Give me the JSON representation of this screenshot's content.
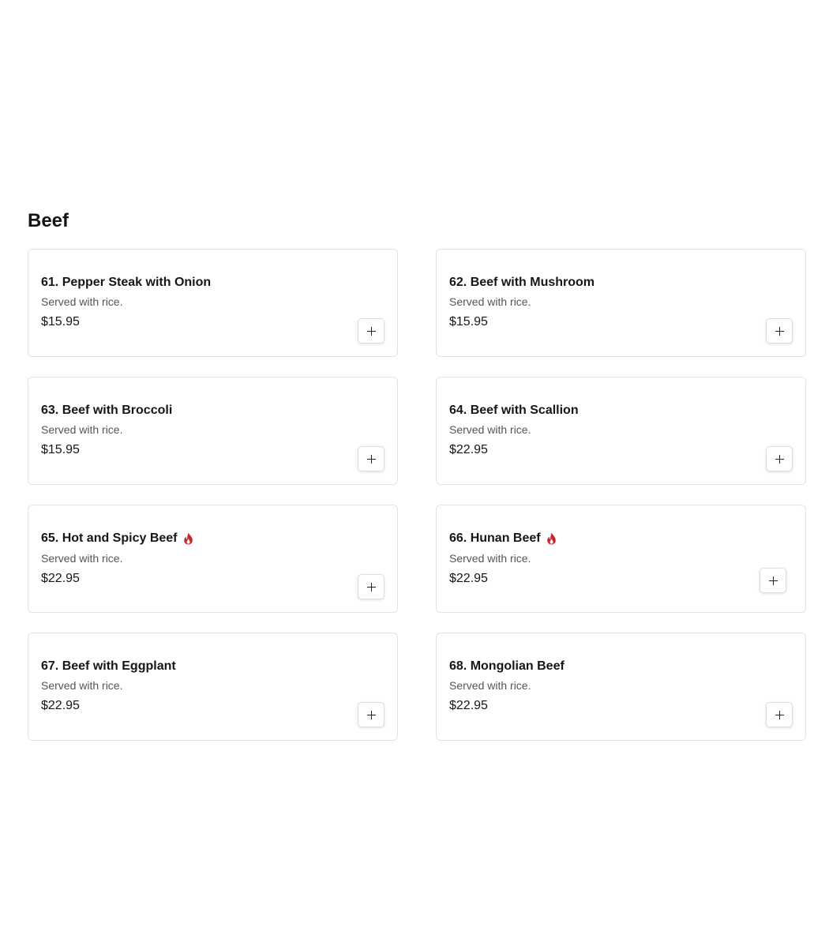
{
  "section": {
    "title": "Beef"
  },
  "colors": {
    "spicy": "#c62828",
    "card_border": "#e3e3e3",
    "text": "#161616",
    "muted": "#555555"
  },
  "items": [
    {
      "name": "61. Pepper Steak with Onion",
      "description": "Served with rice.",
      "price": "$15.95",
      "spicy": false,
      "add_icon": "plus-icon"
    },
    {
      "name": "62. Beef with Mushroom",
      "description": "Served with rice.",
      "price": "$15.95",
      "spicy": false,
      "add_icon": "plus-icon"
    },
    {
      "name": "63. Beef with Broccoli",
      "description": "Served with rice.",
      "price": "$15.95",
      "spicy": false,
      "add_icon": "plus-icon"
    },
    {
      "name": "64. Beef with Scallion",
      "description": "Served with rice.",
      "price": "$22.95",
      "spicy": false,
      "add_icon": "plus-icon"
    },
    {
      "name": "65. Hot and Spicy Beef",
      "description": "Served with rice.",
      "price": "$22.95",
      "spicy": true,
      "spicy_icon": "flame-icon",
      "add_icon": "plus-icon"
    },
    {
      "name": "66. Hunan Beef",
      "description": "Served with rice.",
      "price": "$22.95",
      "spicy": true,
      "spicy_icon": "flame-icon",
      "add_icon": "plus-icon"
    },
    {
      "name": "67. Beef with Eggplant",
      "description": "Served with rice.",
      "price": "$22.95",
      "spicy": false,
      "add_icon": "plus-icon"
    },
    {
      "name": "68. Mongolian Beef",
      "description": "Served with rice.",
      "price": "$22.95",
      "spicy": false,
      "add_icon": "plus-icon"
    }
  ]
}
